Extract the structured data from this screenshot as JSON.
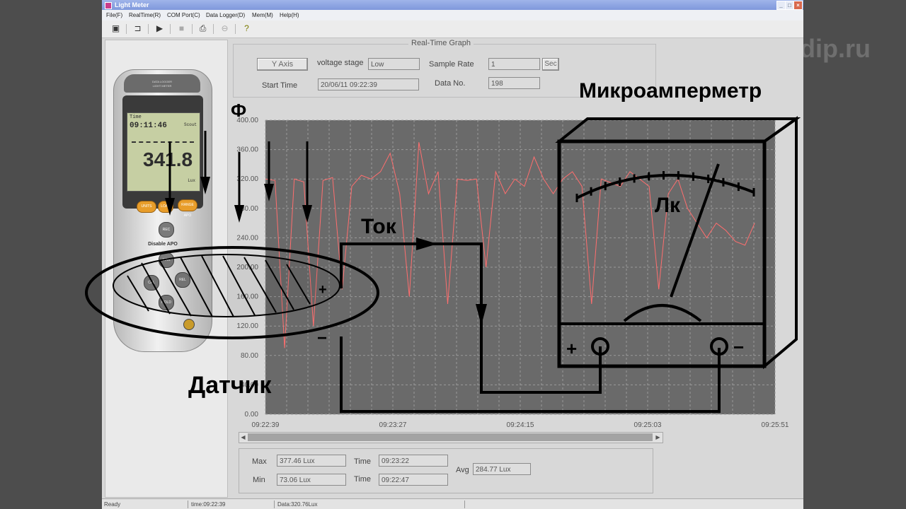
{
  "window": {
    "title": "Light Meter"
  },
  "menu": [
    "File(F)",
    "RealTime(R)",
    "COM Port(C)",
    "Data Logger(D)",
    "Mem(M)",
    "Help(H)"
  ],
  "toolbar": {
    "icons": [
      "save-icon",
      "open-folder-icon",
      "play-icon",
      "stop-icon",
      "print-icon",
      "disconnect-icon",
      "help-icon"
    ]
  },
  "watermark": "dip.ru",
  "device": {
    "brand_line1": "DATA LOGGER",
    "brand_line2": "LIGHT METER",
    "lcd_label_time": "Time",
    "lcd_time": "09:11:46",
    "lcd_mode": "Scout",
    "lcd_value": "341.8",
    "lcd_unit": "Lux",
    "key_units": "UNITS",
    "key_load": "LOAD",
    "key_range": "RANGE APO",
    "key_rec": "REC",
    "apo_text": "Disable APO",
    "key_max": "MAX",
    "key_cal": "CAL",
    "key_rel": "REL",
    "key_hold": "HOLD"
  },
  "realtime": {
    "group_label": "Real-Time   Graph",
    "y_axis_button": "Y Axis",
    "voltage_stage_label": "voltage stage",
    "voltage_stage_value": "Low",
    "sample_rate_label": "Sample Rate",
    "sample_rate_value": "1",
    "sec_button": "Sec",
    "start_time_label": "Start Time",
    "start_time_value": "20/06/11 09:22:39",
    "data_no_label": "Data No.",
    "data_no_value": "198"
  },
  "overlay": {
    "phi_label": "Ф",
    "title": "Микроамперметр",
    "current_label": "Ток",
    "lux_label": "Лк",
    "sensor_label": "Датчик",
    "plus": "+",
    "minus": "−"
  },
  "stats": {
    "max_label": "Max",
    "max_value": "377.46  Lux",
    "max_time_label": "Time",
    "max_time_value": "09:23:22",
    "min_label": "Min",
    "min_value": "73.06  Lux",
    "min_time_label": "Time",
    "min_time_value": "09:22:47",
    "avg_label": "Avg",
    "avg_value": "284.77  Lux"
  },
  "status": {
    "ready": "Ready",
    "time": "time:09:22:39",
    "data": "Data:320.76Lux"
  },
  "chart_data": {
    "type": "line",
    "title": "",
    "xlabel": "",
    "ylabel": "",
    "ylim": [
      0,
      400
    ],
    "yticks": [
      "0.00",
      "40.00",
      "80.00",
      "120.00",
      "160.00",
      "200.00",
      "240.00",
      "280.00",
      "320.00",
      "360.00",
      "400.00"
    ],
    "xticks": [
      "09:22:39",
      "09:23:27",
      "09:24:15",
      "09:25:03",
      "09:25:51"
    ],
    "grid": true,
    "series": [
      {
        "color": "#ff6e6e",
        "x": [
          0,
          4,
          8,
          12,
          16,
          20,
          24,
          28,
          32,
          36,
          40,
          44,
          48,
          52,
          56,
          60,
          64,
          68,
          72,
          76,
          80,
          84,
          88,
          92,
          96,
          100,
          104,
          108,
          112,
          116,
          120,
          124,
          128,
          132,
          136,
          140,
          144,
          148,
          152,
          156,
          160,
          164,
          168,
          172,
          176,
          180,
          184,
          188,
          192,
          196,
          200,
          204
        ],
        "values": [
          320,
          318,
          90,
          320,
          316,
          120,
          318,
          322,
          170,
          310,
          325,
          320,
          330,
          355,
          300,
          160,
          370,
          300,
          330,
          150,
          320,
          318,
          320,
          200,
          330,
          300,
          320,
          310,
          350,
          320,
          300,
          320,
          330,
          310,
          150,
          320,
          315,
          310,
          330,
          320,
          310,
          170,
          300,
          320,
          280,
          260,
          240,
          260,
          250,
          235,
          230,
          260
        ]
      }
    ]
  }
}
